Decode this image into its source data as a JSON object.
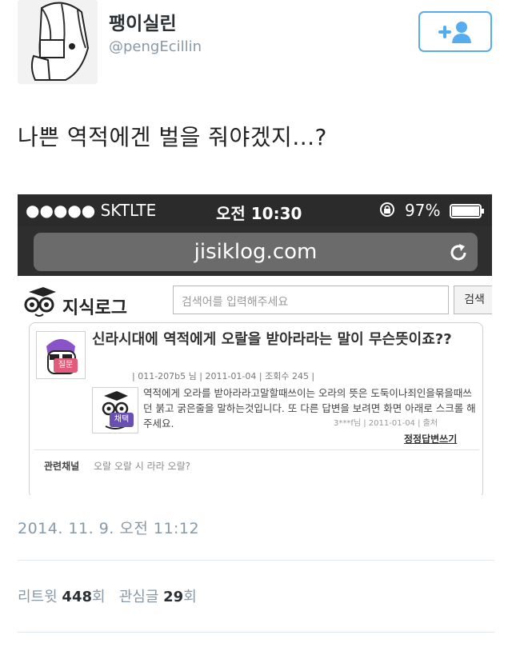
{
  "tweet": {
    "display_name": "팽이실린",
    "handle": "@pengEcillin",
    "text": "나쁜 역적에겐 벌을 줘야겠지...?",
    "timestamp": "2014. 11. 9. 오전 11:12",
    "retweet_label": "리트윗",
    "retweet_count": "448",
    "retweet_unit": "회",
    "favorite_label": "관심글",
    "favorite_count": "29",
    "favorite_unit": "회",
    "follow_icon": "follow-plus-icon",
    "accent_color": "#55acee"
  },
  "phone": {
    "carrier": "●●●●● SKT",
    "network": "LTE",
    "time": "오전 10:30",
    "battery": "97%",
    "url": "jisiklog.com"
  },
  "site": {
    "logo": "지식로그",
    "search_placeholder": "검색어를 입력해주세요",
    "search_button": "검색",
    "question_badge": "질문",
    "question_title": "신라시대에 역적에게 오랄을 받아라라는 말이 무슨뜻이죠??",
    "question_meta": "| 011-207b5 님 | 2011-01-04 | 조회수 245 |",
    "answer_badge": "채택",
    "answer_text": "역적에게 오라를 받아라라고말할때쓰이는 오라의 뜻은 도둑이나죄인을묶을때쓰던 붉고 굵은줄을 말하는것입니다. 또 다른 답변을 보려면 화면 아래로 스크롤 해주세요.",
    "answer_meta": "3***f님 | 2011-01-04 | 출처",
    "answer_link": "정정답변쓰기",
    "related_label": "관련채널",
    "related_link": "오랄 오랄 시 라라 오랄?"
  }
}
